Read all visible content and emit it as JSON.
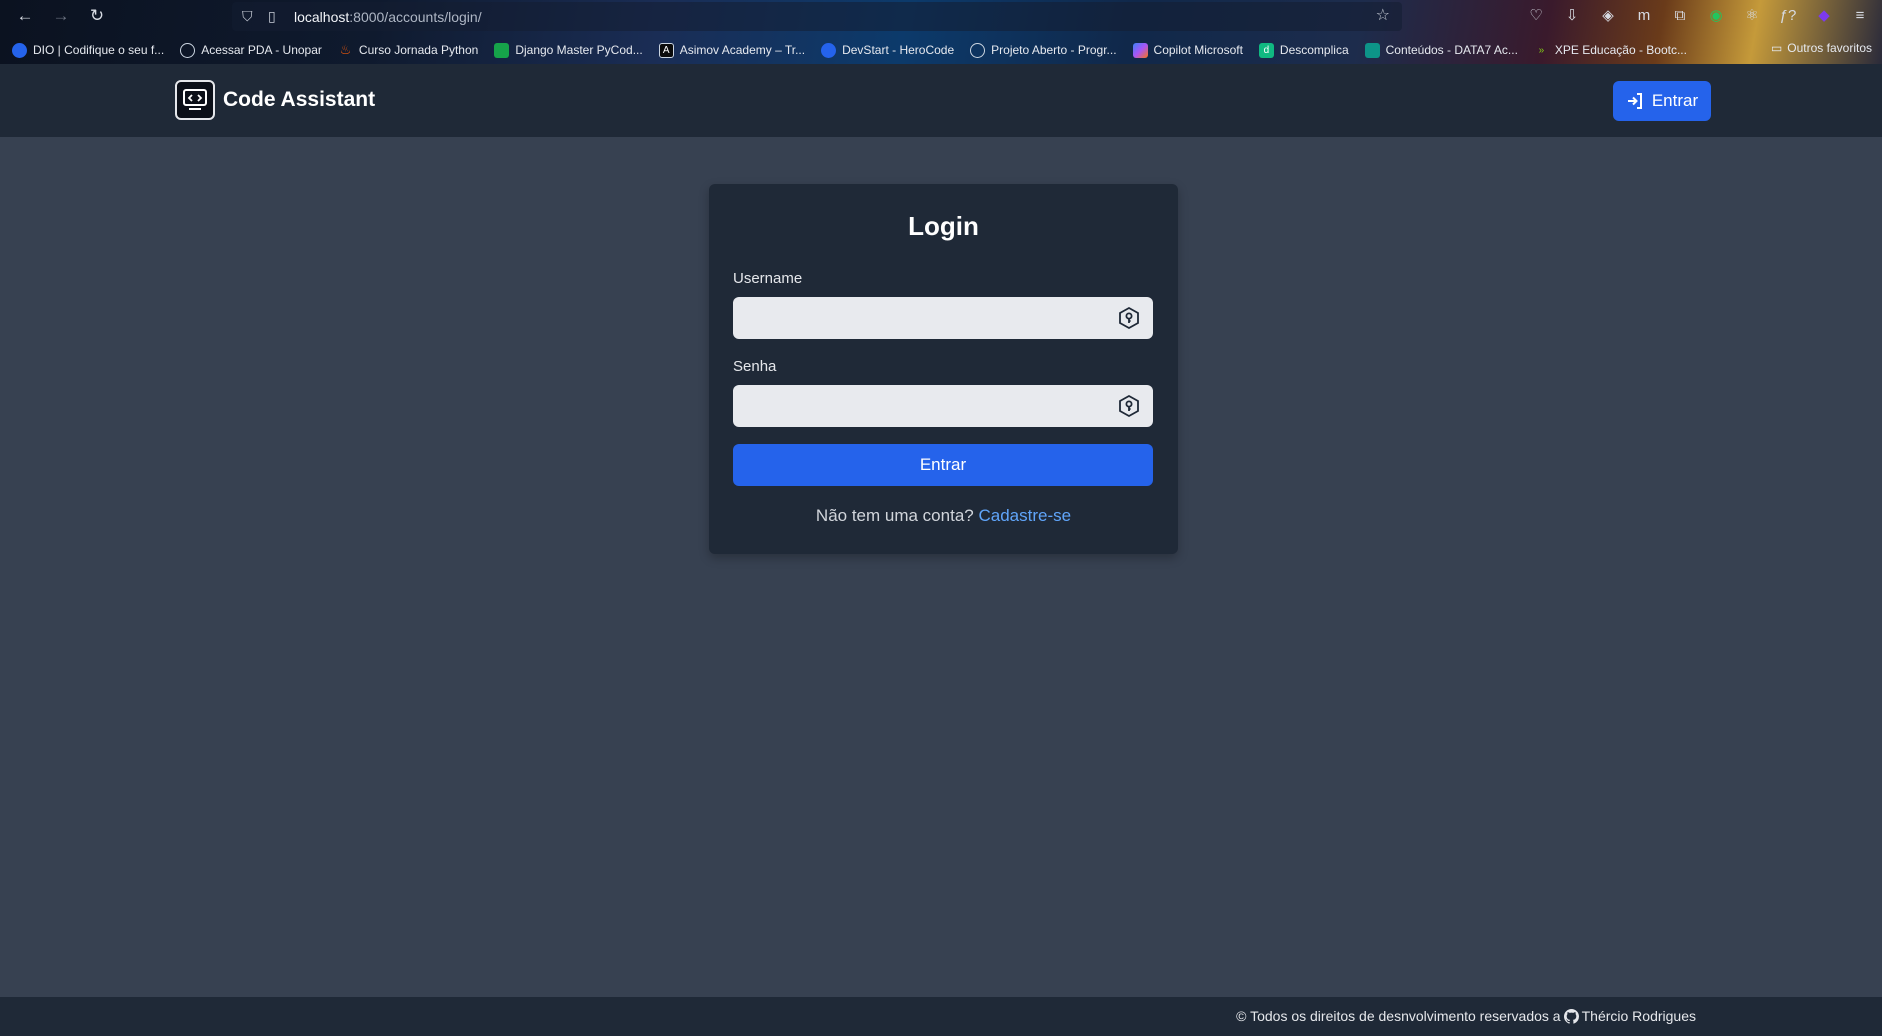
{
  "browser": {
    "url_host": "localhost",
    "url_path": ":8000/accounts/login/",
    "bookmarks": [
      {
        "label": "DIO | Codifique o seu f...",
        "color": "#2563eb"
      },
      {
        "label": "Acessar PDA - Unopar",
        "color": "#6b7280"
      },
      {
        "label": "Curso Jornada Python",
        "color": "#ea580c"
      },
      {
        "label": "Django Master PyCod...",
        "color": "#16a34a"
      },
      {
        "label": "Asimov Academy – Tr...",
        "color": "#111827"
      },
      {
        "label": "DevStart - HeroCode",
        "color": "#2563eb"
      },
      {
        "label": "Projeto Aberto - Progr...",
        "color": "#6b7280"
      },
      {
        "label": "Copilot Microsoft",
        "color": "#a855f7"
      },
      {
        "label": "Descomplica",
        "color": "#10b981"
      },
      {
        "label": "Conteúdos - DATA7 Ac...",
        "color": "#0d9488"
      },
      {
        "label": "XPE Educação - Bootc...",
        "color": "#84cc16"
      }
    ],
    "other_bookmarks": "Outros favoritos"
  },
  "header": {
    "brand": "Code Assistant",
    "login_button": "Entrar"
  },
  "login": {
    "title": "Login",
    "username_label": "Username",
    "username_value": "",
    "password_label": "Senha",
    "password_value": "",
    "submit": "Entrar",
    "signup_prompt": "Não tem uma conta?",
    "signup_link": "Cadastre-se"
  },
  "footer": {
    "text": "© Todos os direitos de desnvolvimento reservados a",
    "author": "Thércio Rodrigues"
  }
}
